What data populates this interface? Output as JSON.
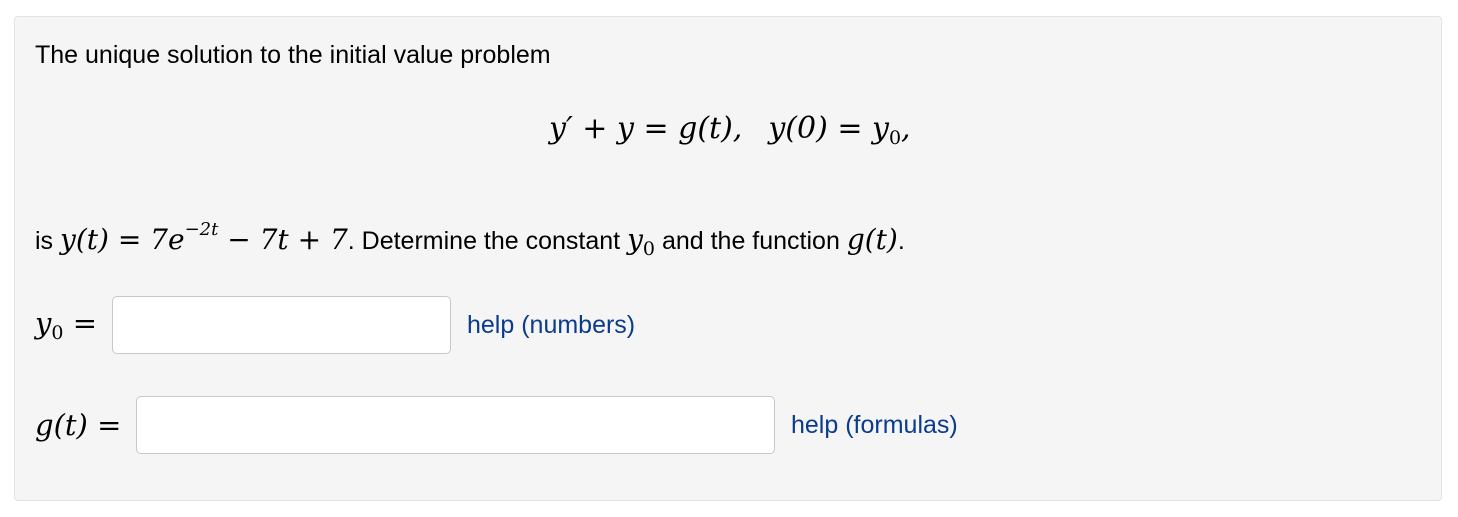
{
  "problem": {
    "intro_text": "The unique solution to the initial value problem",
    "equation": {
      "lhs": "y′ + y = g(t),",
      "y0_lhs": "y(0) = y",
      "y0_sub": "0",
      "tail": ","
    },
    "statement": {
      "prefix": "is ",
      "y_of_t": "y(t) = 7e",
      "exponent": "−2t",
      "rest": " − 7t + 7",
      "mid_text": ". Determine the constant ",
      "y0_var": "y",
      "y0_sub": "0",
      "and_text": " and the function ",
      "g_of_t": "g(t)",
      "end_text": "."
    }
  },
  "answers": {
    "y0": {
      "label_var": "y",
      "label_sub": "0",
      "label_eq": " =",
      "value": "",
      "help_label": "help (numbers)"
    },
    "g": {
      "label": "g(t) =",
      "value": "",
      "help_label": "help (formulas)"
    }
  },
  "colors": {
    "panel_background": "#f5f5f5",
    "help_link": "#0b3b8c"
  }
}
